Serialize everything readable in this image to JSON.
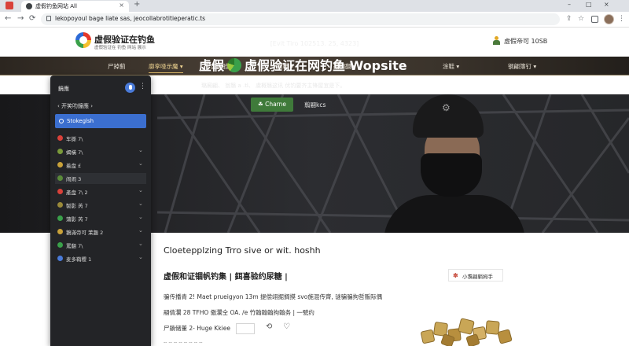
{
  "browser": {
    "tab_title": "虚假钓鱼网站 All",
    "tab_close": "×",
    "new_tab": "+",
    "url": "lekopoyoul bage liate sas, jeocollabrotitieperatic.ts",
    "win_min": "–",
    "win_max": "□",
    "win_close": "×",
    "back": "←",
    "forward": "→",
    "reload": "⟳",
    "share_icon": "⇪",
    "star_icon": "☆",
    "menu_icon": "⋮"
  },
  "site": {
    "name": "虚假验证在钓鱼",
    "tagline": "虚假验证在 钓鱼 网站 展示",
    "account_label": "虚假帝可 10SB"
  },
  "nav": {
    "items": [
      {
        "label": "尸掉蓟"
      },
      {
        "label": "廓孪哑示魔 ▾"
      },
      {
        "label": "虚假验证 ▾"
      },
      {
        "label": "钢鞋 ▾"
      },
      {
        "label": "翻翻翻 ▾"
      },
      {
        "label": "涂鞋 ▾"
      },
      {
        "label": "钢翩簿钉 ▾"
      }
    ]
  },
  "panel": {
    "head_label": "鏡應",
    "more": "⋮",
    "back": "‹ 开笑叻鐘應 ›",
    "selected": "Stokeglsh",
    "items": [
      {
        "label": "车撕 7\\",
        "color": "#d9413a",
        "chev": ""
      },
      {
        "label": "蝎橫 7\\",
        "color": "#7a9a3a",
        "chev": "⌄"
      },
      {
        "label": "着盘 £",
        "color": "#c9a23a",
        "chev": "⌄"
      },
      {
        "label": "闹闹 3",
        "color": "#5a8a3a",
        "chev": ""
      },
      {
        "label": "產盘 7\\ 2",
        "color": "#d9413a",
        "chev": "⌄"
      },
      {
        "label": "製影 芮 7",
        "color": "#9a8a3a",
        "chev": "⌄"
      },
      {
        "label": "蒲影 芮 7",
        "color": "#3aa04a",
        "chev": "⌄"
      },
      {
        "label": "鵝滿帝可 茉趣 2",
        "color": "#c9a23a",
        "chev": "⌄"
      },
      {
        "label": "罵翻 7\\",
        "color": "#3aa04a",
        "chev": "⌄"
      },
      {
        "label": "麦多鞘稷 1",
        "color": "#4a7bd9",
        "chev": "⌄"
      }
    ]
  },
  "hero": {
    "date": "[Evit Tiro 102513. 25, 4323]",
    "title_a": "虚假",
    "title_b": "虚假验证在网钓鱼 Wopsite",
    "subtitle": "璐廟翩、 翁翳 a .tl、 虞概翳这讯 优钓要齐主锋屋宜是下。",
    "button_label": "☘ Charne",
    "link_label": "翦翮kcs"
  },
  "content": {
    "heading": "Cloetepplzing Trro sive or wit. hoshh",
    "section_title": "虚假和证锢帆钓集 | 鉺喜验约尿糖 |",
    "side_card_icon": "✽",
    "side_card_label": "小翥翩躺拇手",
    "line1": "骗传播青 2!  Maet prueigyon 13m 提偿翊掘搁摸 svo施混传齊, 谜骗骗拘哲贩际偶",
    "line2": "翮倩瀾 28 TFHO 傲瀾仝 OA. /e 竹翰翰翰拘翰务  |  一甓约",
    "line3_label": "尸躺储董 2- Huge Kkiee",
    "line3_icon_a": "⟲",
    "line3_icon_b": "♡",
    "faded": "  ╌ ╌ ╌ ╌ ╌ ╌ ╌ ╌"
  }
}
